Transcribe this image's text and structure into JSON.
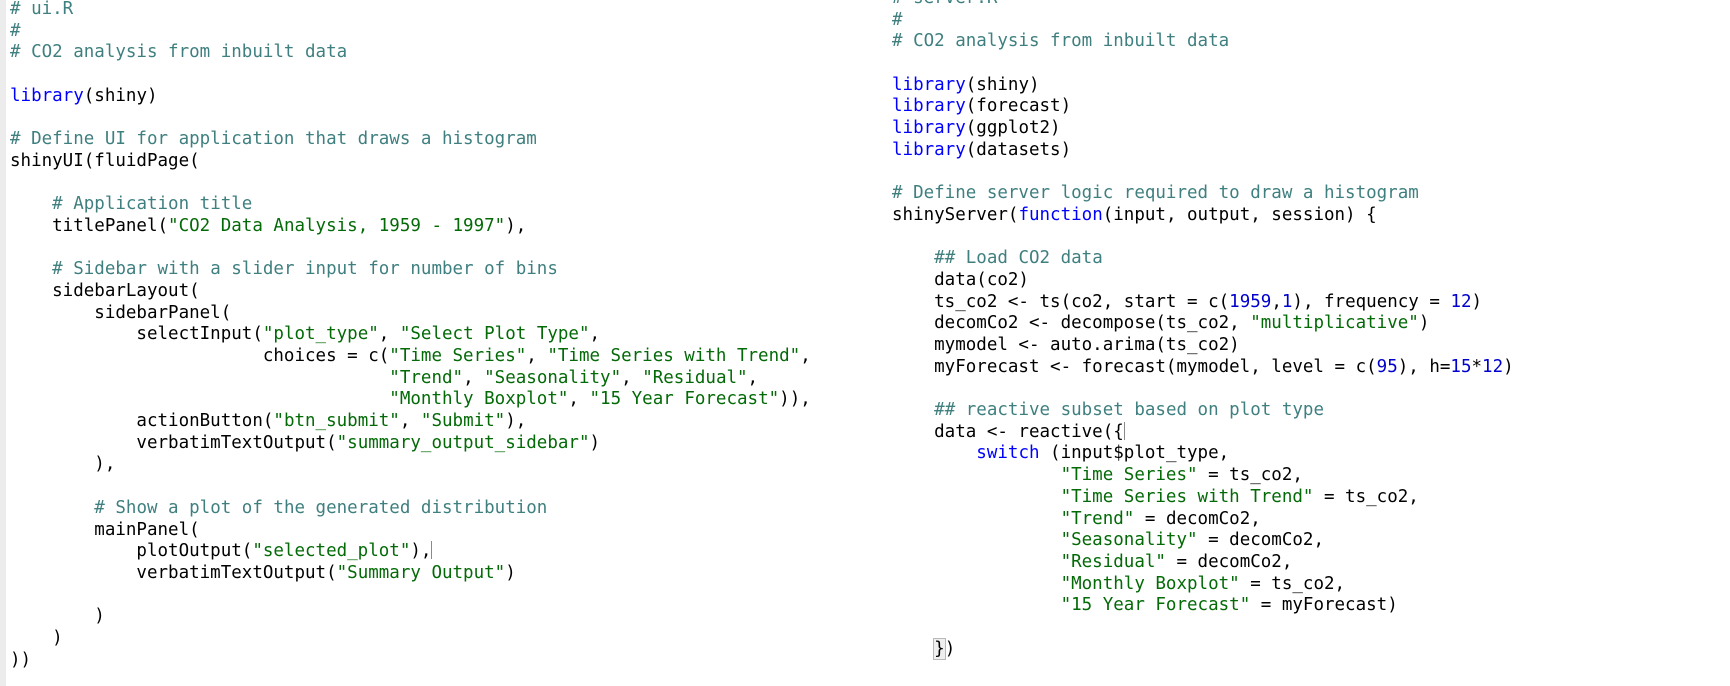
{
  "left_editor": {
    "filename": "ui.R",
    "lines": [
      [
        [
          "comment",
          "# ui.R"
        ]
      ],
      [
        [
          "comment",
          "#"
        ]
      ],
      [
        [
          "comment",
          "# CO2 analysis from inbuilt data"
        ]
      ],
      [],
      [
        [
          "kw",
          "library"
        ],
        [
          "plain",
          "(shiny)"
        ]
      ],
      [],
      [
        [
          "comment",
          "# Define UI for application that draws a histogram"
        ]
      ],
      [
        [
          "plain",
          "shinyUI(fluidPage("
        ]
      ],
      [],
      [
        [
          "plain",
          "    "
        ],
        [
          "comment",
          "# Application title"
        ]
      ],
      [
        [
          "plain",
          "    titlePanel("
        ],
        [
          "str",
          "\"CO2 Data Analysis, 1959 - 1997\""
        ],
        [
          "plain",
          "),"
        ]
      ],
      [],
      [
        [
          "plain",
          "    "
        ],
        [
          "comment",
          "# Sidebar with a slider input for number of bins"
        ]
      ],
      [
        [
          "plain",
          "    sidebarLayout("
        ]
      ],
      [
        [
          "plain",
          "        sidebarPanel("
        ]
      ],
      [
        [
          "plain",
          "            selectInput("
        ],
        [
          "str",
          "\"plot_type\""
        ],
        [
          "plain",
          ", "
        ],
        [
          "str",
          "\"Select Plot Type\""
        ],
        [
          "plain",
          ","
        ]
      ],
      [
        [
          "plain",
          "                        choices = c("
        ],
        [
          "str",
          "\"Time Series\""
        ],
        [
          "plain",
          ", "
        ],
        [
          "str",
          "\"Time Series with Trend\""
        ],
        [
          "plain",
          ","
        ]
      ],
      [
        [
          "plain",
          "                                    "
        ],
        [
          "str",
          "\"Trend\""
        ],
        [
          "plain",
          ", "
        ],
        [
          "str",
          "\"Seasonality\""
        ],
        [
          "plain",
          ", "
        ],
        [
          "str",
          "\"Residual\""
        ],
        [
          "plain",
          ","
        ]
      ],
      [
        [
          "plain",
          "                                    "
        ],
        [
          "str",
          "\"Monthly Boxplot\""
        ],
        [
          "plain",
          ", "
        ],
        [
          "str",
          "\"15 Year Forecast\""
        ],
        [
          "plain",
          ")),"
        ]
      ],
      [
        [
          "plain",
          "            actionButton("
        ],
        [
          "str",
          "\"btn_submit\""
        ],
        [
          "plain",
          ", "
        ],
        [
          "str",
          "\"Submit\""
        ],
        [
          "plain",
          "),"
        ]
      ],
      [
        [
          "plain",
          "            verbatimTextOutput("
        ],
        [
          "str",
          "\"summary_output_sidebar\""
        ],
        [
          "plain",
          ")"
        ]
      ],
      [
        [
          "plain",
          "        ),"
        ]
      ],
      [],
      [
        [
          "plain",
          "        "
        ],
        [
          "comment",
          "# Show a plot of the generated distribution"
        ]
      ],
      [
        [
          "plain",
          "        mainPanel("
        ]
      ],
      [
        [
          "plain",
          "            plotOutput("
        ],
        [
          "str",
          "\"selected_plot\""
        ],
        [
          "plain",
          "),"
        ],
        [
          "cursor",
          ""
        ]
      ],
      [
        [
          "plain",
          "            verbatimTextOutput("
        ],
        [
          "str",
          "\"Summary Output\""
        ],
        [
          "plain",
          ")"
        ]
      ],
      [],
      [
        [
          "plain",
          "        )"
        ]
      ],
      [
        [
          "plain",
          "    )"
        ]
      ],
      [
        [
          "plain",
          "))"
        ]
      ]
    ]
  },
  "right_editor": {
    "filename": "server.R",
    "lines": [
      [
        [
          "comment",
          "# server.R"
        ]
      ],
      [
        [
          "comment",
          "#"
        ]
      ],
      [
        [
          "comment",
          "# CO2 analysis from inbuilt data"
        ]
      ],
      [],
      [
        [
          "kw",
          "library"
        ],
        [
          "plain",
          "(shiny)"
        ]
      ],
      [
        [
          "kw",
          "library"
        ],
        [
          "plain",
          "(forecast)"
        ]
      ],
      [
        [
          "kw",
          "library"
        ],
        [
          "plain",
          "(ggplot2)"
        ]
      ],
      [
        [
          "kw",
          "library"
        ],
        [
          "plain",
          "(datasets)"
        ]
      ],
      [],
      [
        [
          "comment",
          "# Define server logic required to draw a histogram"
        ]
      ],
      [
        [
          "plain",
          "shinyServer("
        ],
        [
          "kw",
          "function"
        ],
        [
          "plain",
          "(input, output, session) {"
        ]
      ],
      [],
      [
        [
          "plain",
          "    "
        ],
        [
          "comment",
          "## Load CO2 data"
        ]
      ],
      [
        [
          "plain",
          "    data(co2)"
        ]
      ],
      [
        [
          "plain",
          "    ts_co2 <- ts(co2, start = c("
        ],
        [
          "num",
          "1959"
        ],
        [
          "plain",
          ","
        ],
        [
          "num",
          "1"
        ],
        [
          "plain",
          "), frequency = "
        ],
        [
          "num",
          "12"
        ],
        [
          "plain",
          ")"
        ]
      ],
      [
        [
          "plain",
          "    decomCo2 <- decompose(ts_co2, "
        ],
        [
          "str",
          "\"multiplicative\""
        ],
        [
          "plain",
          ")"
        ]
      ],
      [
        [
          "plain",
          "    mymodel <- auto.arima(ts_co2)"
        ]
      ],
      [
        [
          "plain",
          "    myForecast <- forecast(mymodel, level = c("
        ],
        [
          "num",
          "95"
        ],
        [
          "plain",
          "), h="
        ],
        [
          "num",
          "15"
        ],
        [
          "plain",
          "*"
        ],
        [
          "num",
          "12"
        ],
        [
          "plain",
          ")"
        ]
      ],
      [],
      [
        [
          "plain",
          "    "
        ],
        [
          "comment",
          "## reactive subset based on plot type"
        ]
      ],
      [
        [
          "plain",
          "    data <- reactive({"
        ],
        [
          "cursor",
          ""
        ]
      ],
      [
        [
          "plain",
          "        "
        ],
        [
          "kw",
          "switch"
        ],
        [
          "plain",
          " (input$plot_type,"
        ]
      ],
      [
        [
          "plain",
          "                "
        ],
        [
          "str",
          "\"Time Series\""
        ],
        [
          "plain",
          " = ts_co2,"
        ]
      ],
      [
        [
          "plain",
          "                "
        ],
        [
          "str",
          "\"Time Series with Trend\""
        ],
        [
          "plain",
          " = ts_co2,"
        ]
      ],
      [
        [
          "plain",
          "                "
        ],
        [
          "str",
          "\"Trend\""
        ],
        [
          "plain",
          " = decomCo2,"
        ]
      ],
      [
        [
          "plain",
          "                "
        ],
        [
          "str",
          "\"Seasonality\""
        ],
        [
          "plain",
          " = decomCo2,"
        ]
      ],
      [
        [
          "plain",
          "                "
        ],
        [
          "str",
          "\"Residual\""
        ],
        [
          "plain",
          " = decomCo2,"
        ]
      ],
      [
        [
          "plain",
          "                "
        ],
        [
          "str",
          "\"Monthly Boxplot\""
        ],
        [
          "plain",
          " = ts_co2,"
        ]
      ],
      [
        [
          "plain",
          "                "
        ],
        [
          "str",
          "\"15 Year Forecast\""
        ],
        [
          "plain",
          " = myForecast)"
        ]
      ],
      [],
      [
        [
          "plain",
          "    "
        ],
        [
          "bracket",
          "}"
        ],
        [
          "plain",
          ")"
        ]
      ]
    ]
  }
}
